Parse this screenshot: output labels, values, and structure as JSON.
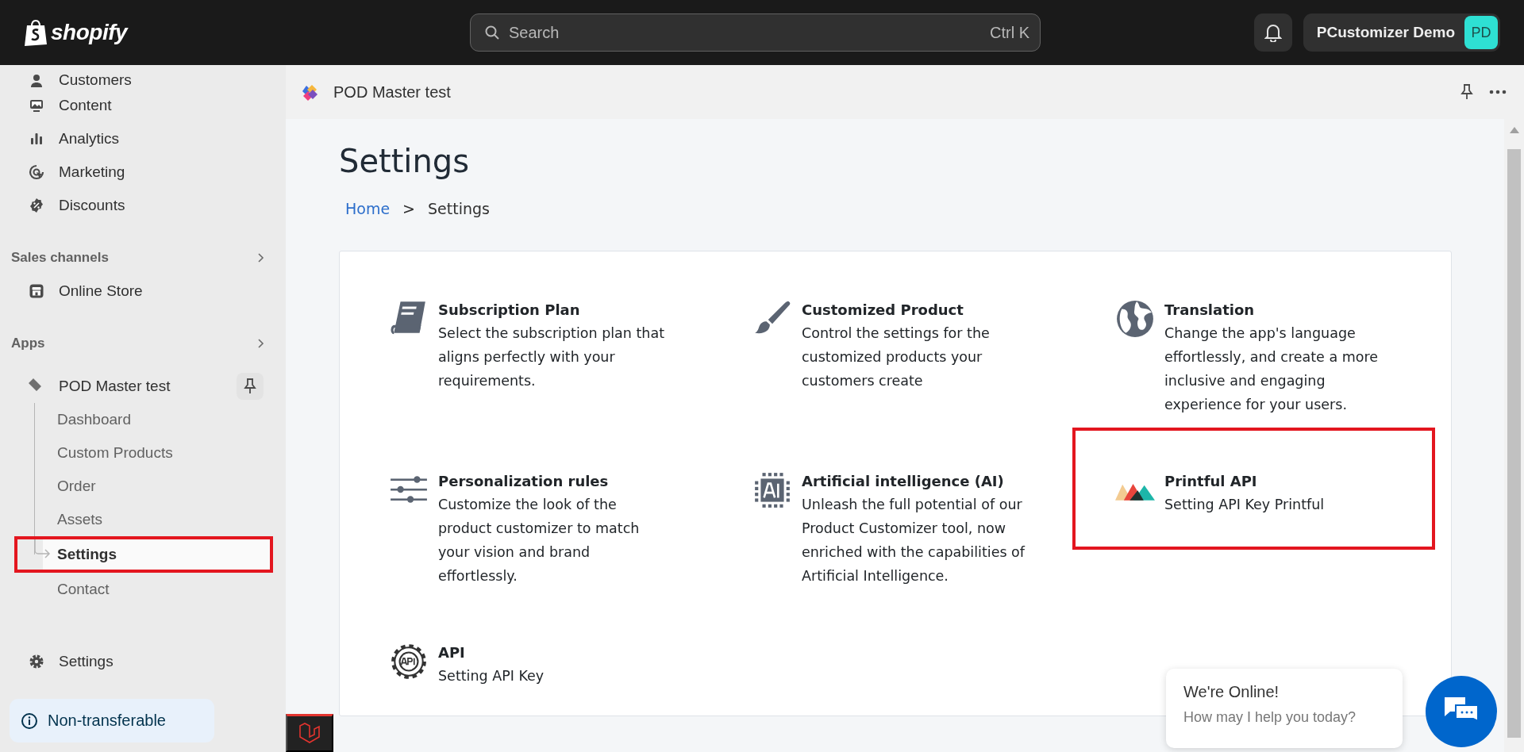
{
  "topbar": {
    "logo": "shopify",
    "search": {
      "placeholder": "Search",
      "shortcut": "Ctrl K"
    },
    "store": {
      "name": "PCustomizer Demo",
      "initials": "PD"
    }
  },
  "sidebar": {
    "items": [
      {
        "label": "Customers",
        "kind": "person"
      },
      {
        "label": "Content",
        "kind": "content"
      },
      {
        "label": "Analytics",
        "kind": "analytics"
      },
      {
        "label": "Marketing",
        "kind": "marketing"
      },
      {
        "label": "Discounts",
        "kind": "discount"
      }
    ],
    "sales_channels": {
      "title": "Sales channels",
      "items": [
        {
          "label": "Online Store",
          "kind": "store"
        }
      ]
    },
    "apps": {
      "title": "Apps",
      "app": {
        "name": "POD Master test",
        "children": [
          {
            "label": "Dashboard",
            "selected": false,
            "highlighted": false
          },
          {
            "label": "Custom Products",
            "selected": false,
            "highlighted": false
          },
          {
            "label": "Order",
            "selected": false,
            "highlighted": false
          },
          {
            "label": "Assets",
            "selected": false,
            "highlighted": false
          },
          {
            "label": "Settings",
            "selected": true,
            "highlighted": true
          },
          {
            "label": "Contact",
            "selected": false,
            "highlighted": false
          }
        ]
      }
    },
    "bottom_items": [
      {
        "label": "Settings",
        "kind": "gear"
      }
    ],
    "notice": "Non-transferable"
  },
  "app_header": {
    "title": "POD Master test"
  },
  "page": {
    "title": "Settings",
    "breadcrumb": [
      {
        "label": "Home",
        "kind": "link"
      },
      {
        "label": ">",
        "kind": "separator"
      },
      {
        "label": "Settings",
        "kind": "current"
      }
    ],
    "cards": [
      {
        "kind": "book",
        "title": "Subscription Plan",
        "description": "Select the subscription plan that aligns perfectly with your requirements.",
        "highlighted": false
      },
      {
        "kind": "brush",
        "title": "Customized Product",
        "description": "Control the settings for the customized products your customers create",
        "highlighted": false
      },
      {
        "kind": "globe",
        "title": "Translation",
        "description": "Change the app's language effortlessly, and create a more inclusive and engaging experience for your users.",
        "highlighted": false
      },
      {
        "kind": "sliders",
        "title": "Personalization rules",
        "description": "Customize the look of the product customizer to match your vision and brand effortlessly.",
        "highlighted": false
      },
      {
        "kind": "ai",
        "title": "Artificial intelligence (AI)",
        "description": "Unleash the full potential of our Product Customizer tool, now enriched with the capabilities of Artificial Intelligence.",
        "highlighted": false
      },
      {
        "kind": "mountains",
        "title": "Printful API",
        "description": "Setting API Key Printful",
        "highlighted": true
      },
      {
        "kind": "api",
        "title": "API",
        "description": "Setting API Key",
        "highlighted": false
      }
    ]
  },
  "chat": {
    "title": "We're Online!",
    "subtitle": "How may I help you today?"
  }
}
